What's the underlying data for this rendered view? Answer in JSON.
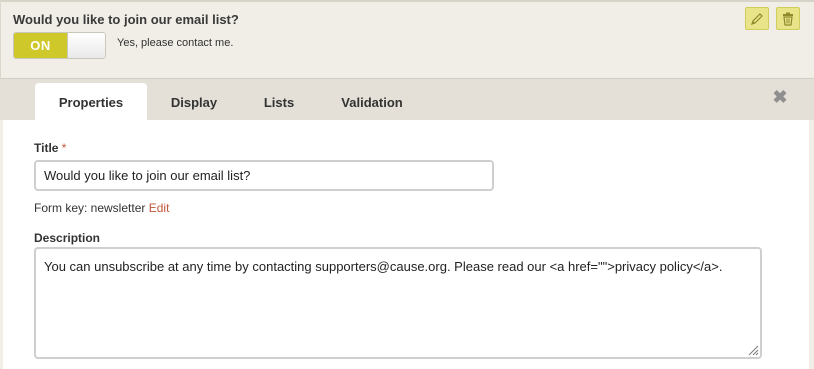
{
  "preview": {
    "question": "Would you like to join our email list?",
    "toggle_state": "ON",
    "toggle_caption": "Yes, please contact me.",
    "edit_icon": "pencil-icon",
    "delete_icon": "trash-icon"
  },
  "tabs": {
    "properties": "Properties",
    "display": "Display",
    "lists": "Lists",
    "validation": "Validation",
    "active": "Properties",
    "close_icon": "close-icon",
    "close_glyph": "✖"
  },
  "form": {
    "title_label": "Title",
    "required_mark": "*",
    "title_value": "Would you like to join our email list?",
    "form_key_label": "Form key: newsletter",
    "form_key_edit": "Edit",
    "description_label": "Description",
    "description_value": "You can unsubscribe at any time by contacting supporters@cause.org. Please read our <a href=\"\">privacy policy</a>."
  },
  "colors": {
    "accent": "#cfc82a",
    "link": "#c4563b",
    "background": "#f1eee7"
  }
}
